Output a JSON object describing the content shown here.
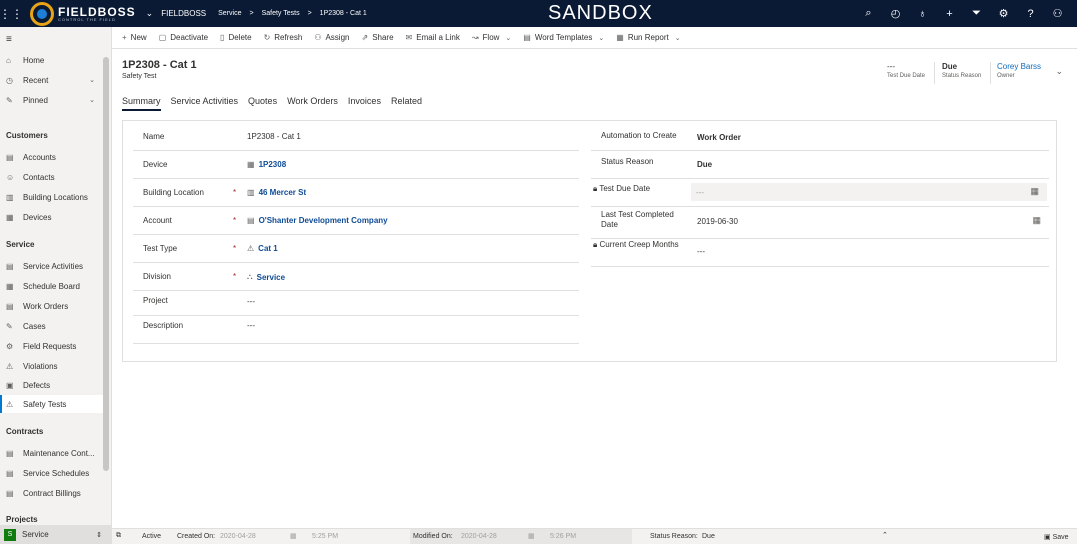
{
  "topbar": {
    "logo_main": "FIELDBOSS",
    "logo_sub": "CONTROL THE FIELD",
    "app_name": "FIELDBOSS",
    "breadcrumbs": [
      "Service",
      ">",
      "Safety Tests",
      ">",
      "1P2308 - Cat 1"
    ],
    "environment": "SANDBOX",
    "icons": [
      "search-icon",
      "task-icon",
      "lightbulb-icon",
      "plus-icon",
      "filter-icon",
      "gear-icon",
      "help-icon",
      "user-icon"
    ]
  },
  "leftnav": {
    "top_items": [
      {
        "label": "Home",
        "icon": "home-icon"
      },
      {
        "label": "Recent",
        "icon": "clock-icon"
      },
      {
        "label": "Pinned",
        "icon": "pin-icon"
      }
    ],
    "groups": [
      {
        "title": "Customers",
        "items": [
          "Accounts",
          "Contacts",
          "Building Locations",
          "Devices"
        ]
      },
      {
        "title": "Service",
        "items": [
          "Service Activities",
          "Schedule Board",
          "Work Orders",
          "Cases",
          "Field Requests",
          "Violations",
          "Defects",
          "Safety Tests"
        ]
      },
      {
        "title": "Contracts",
        "items": [
          "Maintenance Cont...",
          "Service Schedules",
          "Contract Billings"
        ]
      },
      {
        "title": "Projects",
        "items": []
      }
    ],
    "area": {
      "badge": "S",
      "label": "Service"
    }
  },
  "commands": [
    "New",
    "Deactivate",
    "Delete",
    "Refresh",
    "Assign",
    "Share",
    "Email a Link",
    "Flow",
    "Word Templates",
    "Run Report"
  ],
  "header": {
    "title": "1P2308 - Cat 1",
    "entity": "Safety Test",
    "fields": [
      {
        "value": "---",
        "label": "Test Due Date"
      },
      {
        "value": "Due",
        "label": "Status Reason"
      },
      {
        "value": "Corey Barss",
        "label": "Owner"
      }
    ]
  },
  "tabs": [
    "Summary",
    "Service Activities",
    "Quotes",
    "Work Orders",
    "Invoices",
    "Related"
  ],
  "form": {
    "left": [
      {
        "label": "Name",
        "value": "1P2308 - Cat 1",
        "required": false
      },
      {
        "label": "Device",
        "value": "1P2308",
        "required": false
      },
      {
        "label": "Building Location",
        "value": "46 Mercer St",
        "required": true
      },
      {
        "label": "Account",
        "value": "O'Shanter Development Company",
        "required": true
      },
      {
        "label": "Test Type",
        "value": "Cat 1",
        "required": true
      },
      {
        "label": "Division",
        "value": "Service",
        "required": true
      },
      {
        "label": "Project",
        "value": "---",
        "required": false
      },
      {
        "label": "Description",
        "value": "---",
        "required": false
      }
    ],
    "right": [
      {
        "label": "Automation to Create",
        "value": "Work Order"
      },
      {
        "label": "Status Reason",
        "value": "Due"
      },
      {
        "label": "Test Due Date",
        "value": "---"
      },
      {
        "label": "Last Test Completed Date",
        "value": "2019-06-30"
      },
      {
        "label": "Current Creep Months",
        "value": "---"
      }
    ]
  },
  "statusbar": {
    "state": "Active",
    "created_label": "Created On:",
    "created_date": "2020-04-28",
    "created_time": "5:25 PM",
    "modified_label": "Modified On:",
    "modified_date": "2020-04-28",
    "modified_time": "5:26 PM",
    "status_label": "Status Reason:",
    "status_value": "Due",
    "save_label": "Save"
  }
}
